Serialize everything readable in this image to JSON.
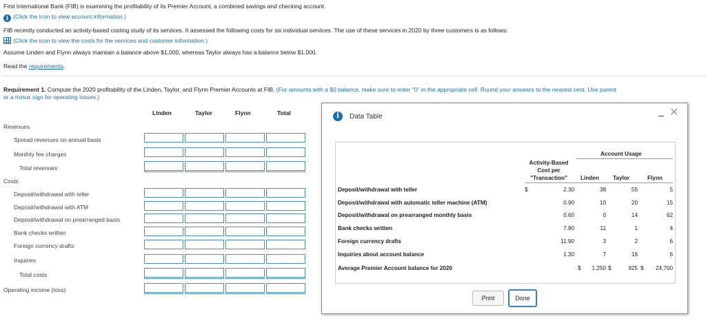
{
  "intro": {
    "line1": "First International Bank (FIB) is examining the profitability of its Premier Account, a combined savings and checking account.",
    "info_link": "(Click the icon to view account information.)",
    "line2": "FIB recently conducted an activity-based costing study of its services. It assessed the following costs for six individual services. The use of these services in 2020 by three customers is as follows:",
    "costs_link": "(Click the icon to view the costs for the services and customer information.)",
    "line3": "Assume Linden and Flynn always maintain a balance above $1,000, whereas Taylor always has a balance below $1,000.",
    "read_prefix": "Read the ",
    "requirements_link": "requirements",
    "read_suffix": "."
  },
  "requirement": {
    "label": "Requirement 1.",
    "text": " Compute the 2020 profitability of the Linden, Taylor, and Flynn Premier Accounts at FIB. ",
    "hint": "(For amounts with a $0 balance, make sure to enter \"0\" in the appropriate cell. Round your answers to the nearest cent. Use parent",
    "hint2": "or a minus sign for operating losses.)"
  },
  "table": {
    "columns": [
      "Linden",
      "Taylor",
      "Flynn",
      "Total"
    ],
    "revenues_label": "Revenues",
    "spread": "Spread revenues on annual basis",
    "monthly": "Monthly fee charges",
    "total_revenues": "Total revenues",
    "costs_label": "Costs",
    "dw_teller": "Deposit/withdrawal with teller",
    "dw_atm": "Deposit/withdrawal with ATM",
    "dw_prearranged": "Deposit/withdrawal on prearranged basis",
    "checks": "Bank checks written",
    "foreign": "Foreign currency drafts",
    "inquiries": "Inquiries",
    "total_costs": "Total costs",
    "operating_income": "Operating income (loss)"
  },
  "modal": {
    "title": "Data Table",
    "account_usage": "Account Usage",
    "abc_header": "Activity-Based",
    "abc_header2": "Cost per",
    "abc_header3": "\"Transaction\"",
    "customers": [
      "Linden",
      "Taylor",
      "Flynn"
    ],
    "rows": [
      {
        "label": "Deposit/withdrawal with teller",
        "currency": "$",
        "cost": "2.30",
        "linden": "38",
        "taylor": "55",
        "flynn": "5"
      },
      {
        "label": "Deposit/withdrawal with automatic teller machine (ATM)",
        "currency": "",
        "cost": "0.90",
        "linden": "10",
        "taylor": "20",
        "flynn": "15"
      },
      {
        "label": "Deposit/withdrawal on prearranged monthly basis",
        "currency": "",
        "cost": "0.60",
        "linden": "0",
        "taylor": "14",
        "flynn": "62"
      },
      {
        "label": "Bank checks written",
        "currency": "",
        "cost": "7.90",
        "linden": "11",
        "taylor": "1",
        "flynn": "4"
      },
      {
        "label": "Foreign currency drafts",
        "currency": "",
        "cost": "11.90",
        "linden": "3",
        "taylor": "2",
        "flynn": "6"
      },
      {
        "label": "Inquiries about account balance",
        "currency": "",
        "cost": "1.30",
        "linden": "7",
        "taylor": "16",
        "flynn": "6"
      }
    ],
    "avg": {
      "label": "Average Premier Account balance for 2020",
      "d1": "$",
      "linden": "1,250",
      "d2": "$",
      "taylor": "925",
      "d3": "$",
      "flynn": "24,700"
    },
    "print_label": "Print",
    "done_label": "Done",
    "minimize_symbol": "–",
    "close_symbol": "✕"
  }
}
